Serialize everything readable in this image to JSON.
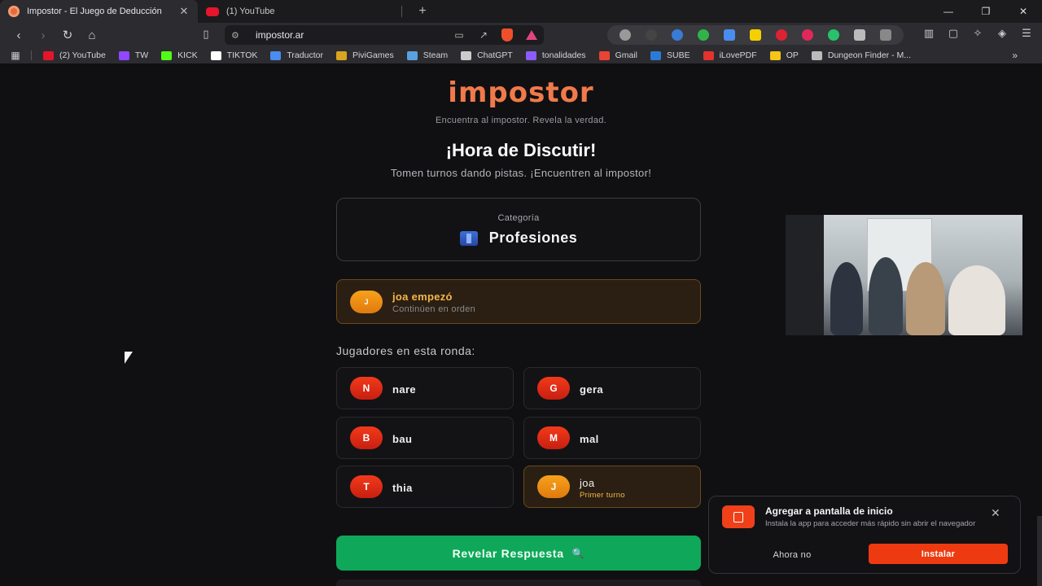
{
  "browser": {
    "tabs": [
      {
        "title": "Impostor - El Juego de Deducción",
        "active": true
      },
      {
        "title": "(1) YouTube",
        "active": false
      }
    ],
    "url": "impostor.ar",
    "bookmarks": [
      {
        "label": "(2) YouTube",
        "color": "#e5152b"
      },
      {
        "label": "TW",
        "color": "#9146ff"
      },
      {
        "label": "KICK",
        "color": "#53fc18"
      },
      {
        "label": "TIKTOK",
        "color": "#ffffff"
      },
      {
        "label": "Traductor",
        "color": "#4a8df0"
      },
      {
        "label": "PiviGames",
        "color": "#d9a520"
      },
      {
        "label": "Steam",
        "color": "#5aa0e0"
      },
      {
        "label": "ChatGPT",
        "color": "#cccccc"
      },
      {
        "label": "tonalidades",
        "color": "#8c5cff"
      },
      {
        "label": "Gmail",
        "color": "#ea4335"
      },
      {
        "label": "SUBE",
        "color": "#2b7bd6"
      },
      {
        "label": "iLovePDF",
        "color": "#e5322d"
      },
      {
        "label": "OP",
        "color": "#f5c518"
      },
      {
        "label": "Dungeon Finder - M...",
        "color": "#bbbbbb"
      }
    ]
  },
  "app": {
    "logo": "impostor",
    "tagline": "Encuentra al impostor. Revela la verdad.",
    "heading": "¡Hora de Discutir!",
    "subheading": "Tomen turnos dando pistas. ¡Encuentren al impostor!",
    "category": {
      "label": "Categoría",
      "value": "Profesiones"
    },
    "starter": {
      "initial": "J",
      "title": "joa empezó",
      "subtitle": "Continúen en orden"
    },
    "players_label": "Jugadores en esta ronda:",
    "players": [
      {
        "initial": "N",
        "name": "nare",
        "tag": ""
      },
      {
        "initial": "G",
        "name": "gera",
        "tag": ""
      },
      {
        "initial": "B",
        "name": "bau",
        "tag": ""
      },
      {
        "initial": "M",
        "name": "mal",
        "tag": ""
      },
      {
        "initial": "T",
        "name": "thia",
        "tag": ""
      },
      {
        "initial": "J",
        "name": "joa",
        "tag": "Primer turno"
      }
    ],
    "reveal_button": "Revelar Respuesta"
  },
  "toast": {
    "title": "Agregar a pantalla de inicio",
    "body": "Instala la app para acceder más rápido sin abrir el navegador",
    "dismiss": "Ahora no",
    "install": "Instalar"
  },
  "colors": {
    "accent_orange": "#f07a4a",
    "reveal_green": "#0fa85a",
    "install_red": "#ee3a10",
    "first_turn_gold": "#f5b64a"
  }
}
